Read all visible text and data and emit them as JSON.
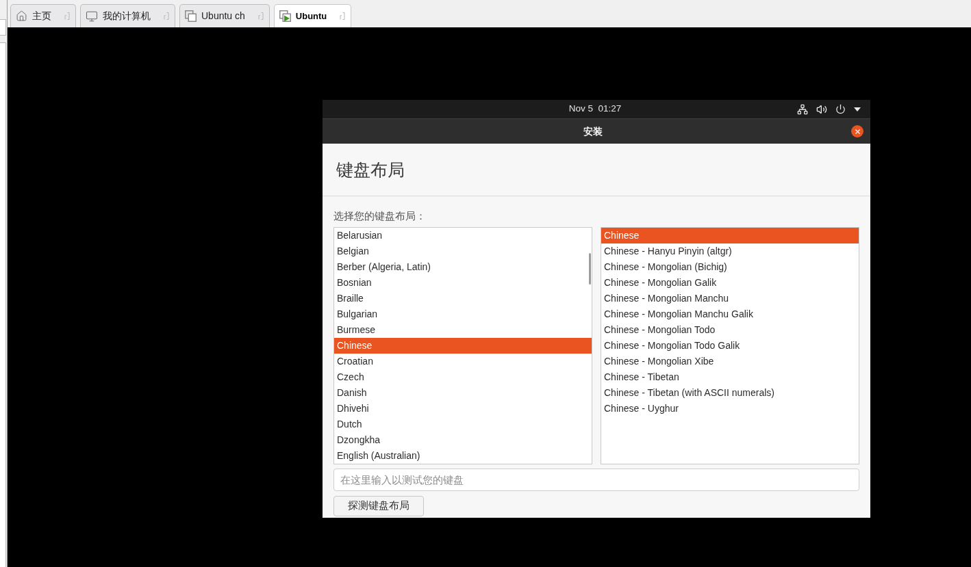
{
  "app_tabs": [
    {
      "kind": "home",
      "label": "主页",
      "selected": false
    },
    {
      "kind": "computer",
      "label": "我的计算机",
      "selected": false
    },
    {
      "kind": "vm",
      "label": "Ubuntu ch",
      "selected": false
    },
    {
      "kind": "vm_running",
      "label": "Ubuntu",
      "selected": true
    }
  ],
  "guest_top_bar": {
    "clock": "Nov 5  01:27"
  },
  "installer": {
    "title": "安装",
    "heading": "键盘布局",
    "prompt": "选择您的键盘布局：",
    "layouts": [
      {
        "label": "Belarusian",
        "selected": false
      },
      {
        "label": "Belgian",
        "selected": false
      },
      {
        "label": "Berber (Algeria, Latin)",
        "selected": false
      },
      {
        "label": "Bosnian",
        "selected": false
      },
      {
        "label": "Braille",
        "selected": false
      },
      {
        "label": "Bulgarian",
        "selected": false
      },
      {
        "label": "Burmese",
        "selected": false
      },
      {
        "label": "Chinese",
        "selected": true
      },
      {
        "label": "Croatian",
        "selected": false
      },
      {
        "label": "Czech",
        "selected": false
      },
      {
        "label": "Danish",
        "selected": false
      },
      {
        "label": "Dhivehi",
        "selected": false
      },
      {
        "label": "Dutch",
        "selected": false
      },
      {
        "label": "Dzongkha",
        "selected": false
      },
      {
        "label": "English (Australian)",
        "selected": false
      }
    ],
    "variants": [
      {
        "label": "Chinese",
        "selected": true
      },
      {
        "label": "Chinese - Hanyu Pinyin (altgr)",
        "selected": false
      },
      {
        "label": "Chinese - Mongolian (Bichig)",
        "selected": false
      },
      {
        "label": "Chinese - Mongolian Galik",
        "selected": false
      },
      {
        "label": "Chinese - Mongolian Manchu",
        "selected": false
      },
      {
        "label": "Chinese - Mongolian Manchu Galik",
        "selected": false
      },
      {
        "label": "Chinese - Mongolian Todo",
        "selected": false
      },
      {
        "label": "Chinese - Mongolian Todo Galik",
        "selected": false
      },
      {
        "label": "Chinese - Mongolian Xibe",
        "selected": false
      },
      {
        "label": "Chinese - Tibetan",
        "selected": false
      },
      {
        "label": "Chinese - Tibetan (with ASCII numerals)",
        "selected": false
      },
      {
        "label": "Chinese - Uyghur",
        "selected": false
      }
    ],
    "test_field": {
      "placeholder": "在这里输入以测试您的键盘"
    },
    "detect_button": "探测键盘布局"
  }
}
